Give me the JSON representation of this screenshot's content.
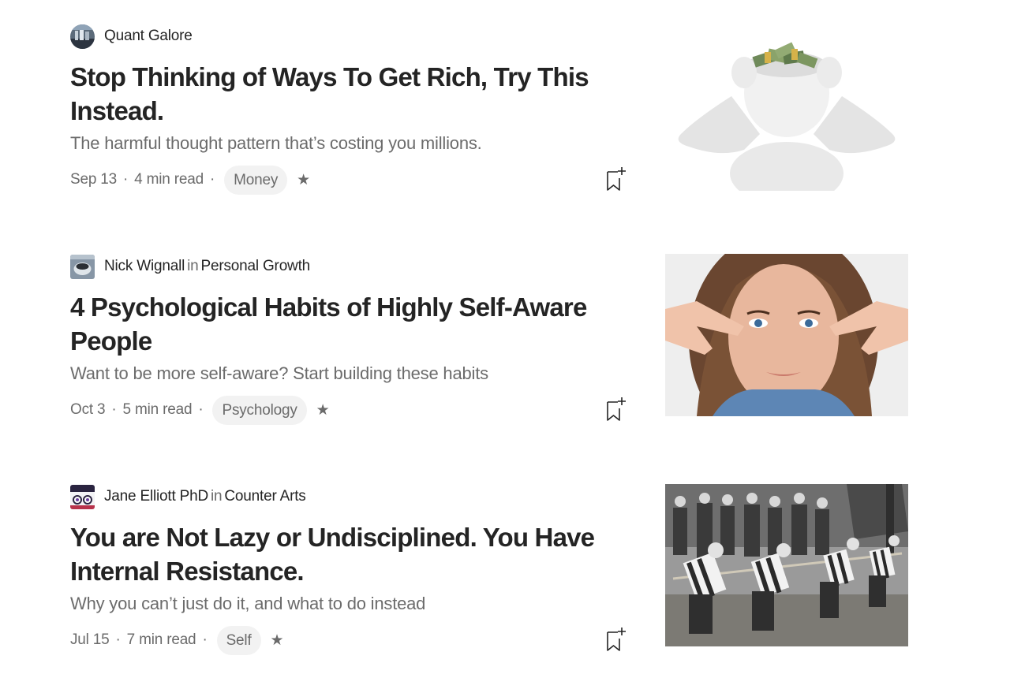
{
  "articles": [
    {
      "author": "Quant Galore",
      "in_label": "",
      "publication": "",
      "title": "Stop Thinking of Ways To Get Rich, Try This Instead.",
      "subtitle": "The harmful thought pattern that’s costing you millions.",
      "date": "Sep 13",
      "read_time": "4 min read",
      "tag": "Money",
      "star": "★",
      "separator": "·",
      "thumbnail_icon": "money-head-figure-image"
    },
    {
      "author": "Nick Wignall",
      "in_label": "in",
      "publication": "Personal Growth",
      "title": "4 Psychological Habits of Highly Self-Aware People",
      "subtitle": "Want to be more self-aware? Start building these habits",
      "date": "Oct 3",
      "read_time": "5 min read",
      "tag": "Psychology",
      "star": "★",
      "separator": "·",
      "thumbnail_icon": "woman-portrait-image"
    },
    {
      "author": "Jane Elliott PhD",
      "in_label": "in",
      "publication": "Counter Arts",
      "title": "You are Not Lazy or Undisciplined. You Have Internal Resistance.",
      "subtitle": "Why you can’t just do it, and what to do instead",
      "date": "Jul 15",
      "read_time": "7 min read",
      "tag": "Self",
      "star": "★",
      "separator": "·",
      "thumbnail_icon": "tug-of-war-photo-image"
    }
  ]
}
